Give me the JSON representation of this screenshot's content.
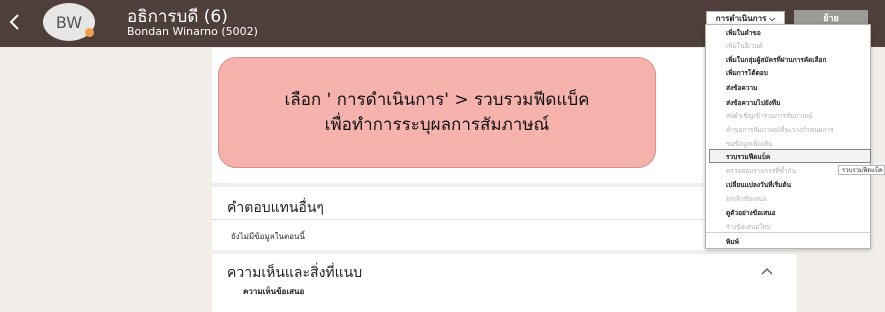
{
  "header": {
    "avatar_initials": "BW",
    "title": "อธิการบดี (6)",
    "subtitle": "Bondan Winarno (5002)",
    "actions_label": "การดำเนินการ ⌵",
    "back_label": "ย้าย"
  },
  "callout": {
    "line1": "เลือก ' การดำเนินการ' > รวบรวมฟีดแบ็ค",
    "line2": "เพื่อทำการระบุผลการสัมภาษณ์"
  },
  "other_answers": {
    "title": "คำตอบแทนอื่นๆ",
    "empty_text": "ยังไม่มีข้อมูลในตอนนี้"
  },
  "comments": {
    "title": "ความเห็นและสิ่งที่แนบ",
    "subheading": "ความเห็นข้อเสนอ"
  },
  "actions_menu": {
    "items": [
      {
        "label": "เพิ่มในคำขอ",
        "enabled": true
      },
      {
        "label": "เพิ่มในอีเวนต์",
        "enabled": false
      },
      {
        "label": "เพิ่มในกลุ่มผู้สมัครที่ผ่านการคัดเลือก",
        "enabled": true
      },
      {
        "label": "เพิ่มการโต้ตอบ",
        "enabled": true
      },
      {
        "label": "ส่งข้อความ",
        "enabled": true
      },
      {
        "label": "ส่งข้อความไปยังทีม",
        "enabled": true
      },
      {
        "label": "ส่งคำเชิญเข้าร่วมการสัมภาษณ์",
        "enabled": false
      },
      {
        "label": "คำขอการสัมภาษณ์ที่จะวางกำหนดการ",
        "enabled": false
      },
      {
        "label": "ขอข้อมูลเพิ่มเติม",
        "enabled": false
      },
      {
        "label": "รวบรวมฟีดแบ็ค",
        "enabled": true
      },
      {
        "label": "ตรวจสอบรายการที่ซ้ำกัน",
        "enabled": false
      },
      {
        "label": "เปลี่ยนแปลงวันที่เริ่มต้น",
        "enabled": true
      },
      {
        "label": "ยกเลิกข้อเสนอ",
        "enabled": false
      },
      {
        "label": "ดูตัวอย่างข้อเสนอ",
        "enabled": true
      },
      {
        "label": "ร่างข้อเสนอใหม่",
        "enabled": false
      },
      {
        "label": "พิมพ์",
        "enabled": true
      }
    ],
    "tooltip": "รวบรวมฟีดแบ็ค"
  }
}
